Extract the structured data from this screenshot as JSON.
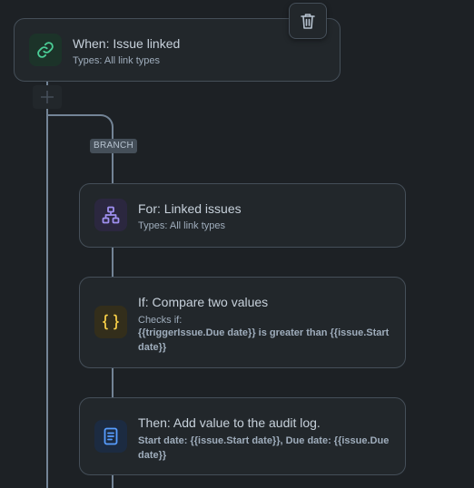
{
  "trigger": {
    "title": "When: Issue linked",
    "subtitle": "Types: All link types",
    "icon": "link-icon",
    "icon_color": "#4bce97"
  },
  "branch_label": "BRANCH",
  "branch_card": {
    "title": "For: Linked issues",
    "subtitle": "Types: All link types",
    "icon": "hierarchy-icon",
    "icon_color": "#9f8fef"
  },
  "condition": {
    "title": "If: Compare two values",
    "checks_label": "Checks if:",
    "detail": "{{triggerIssue.Due date}} is greater than {{issue.Start date}}",
    "icon": "braces-icon",
    "icon_color": "#f5cd47"
  },
  "action": {
    "title": "Then: Add value to the audit log.",
    "detail": "Start date: {{issue.Start date}}, Due date: {{issue.Due date}}",
    "icon": "document-icon",
    "icon_color": "#579dff"
  },
  "colors": {
    "background": "#1d2125",
    "card": "#22272b",
    "border": "#454f59",
    "connector": "#738496"
  }
}
